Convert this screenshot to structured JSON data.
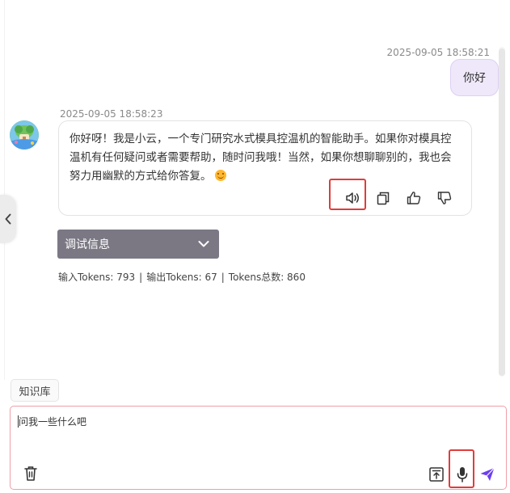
{
  "user_message": {
    "timestamp": "2025-09-05 18:58:21",
    "text": "你好"
  },
  "bot_message": {
    "timestamp": "2025-09-05 18:58:23",
    "text": "你好呀！我是小云，一个专门研究水式模具控温机的智能助手。如果你对模具控温机有任何疑问或者需要帮助，随时问我哦！当然，如果你想聊聊别的，我也会努力用幽默的方式给你答复。",
    "emoji": "smiling-face"
  },
  "debug": {
    "label": "调试信息",
    "input_tokens": "输入Tokens: 793",
    "output_tokens": "输出Tokens: 67",
    "total_tokens": "Tokens总数: 860",
    "separator": "|"
  },
  "knowledge_base": {
    "label": "知识库"
  },
  "composer": {
    "placeholder": "问我一些什么吧",
    "value": ""
  },
  "icons": {
    "speaker": "speaker-icon",
    "copy": "copy-icon",
    "like": "thumbs-up-icon",
    "dislike": "thumbs-down-icon",
    "collapse": "chevron-left-icon",
    "dropdown": "chevron-down-icon",
    "trash": "trash-icon",
    "upload": "upload-icon",
    "mic": "microphone-icon",
    "send": "send-icon"
  },
  "colors": {
    "accent": "#6c3ff0",
    "highlight": "#e03c3c",
    "user_bubble": "#efe8fb",
    "debug_bar": "#7b7884"
  }
}
